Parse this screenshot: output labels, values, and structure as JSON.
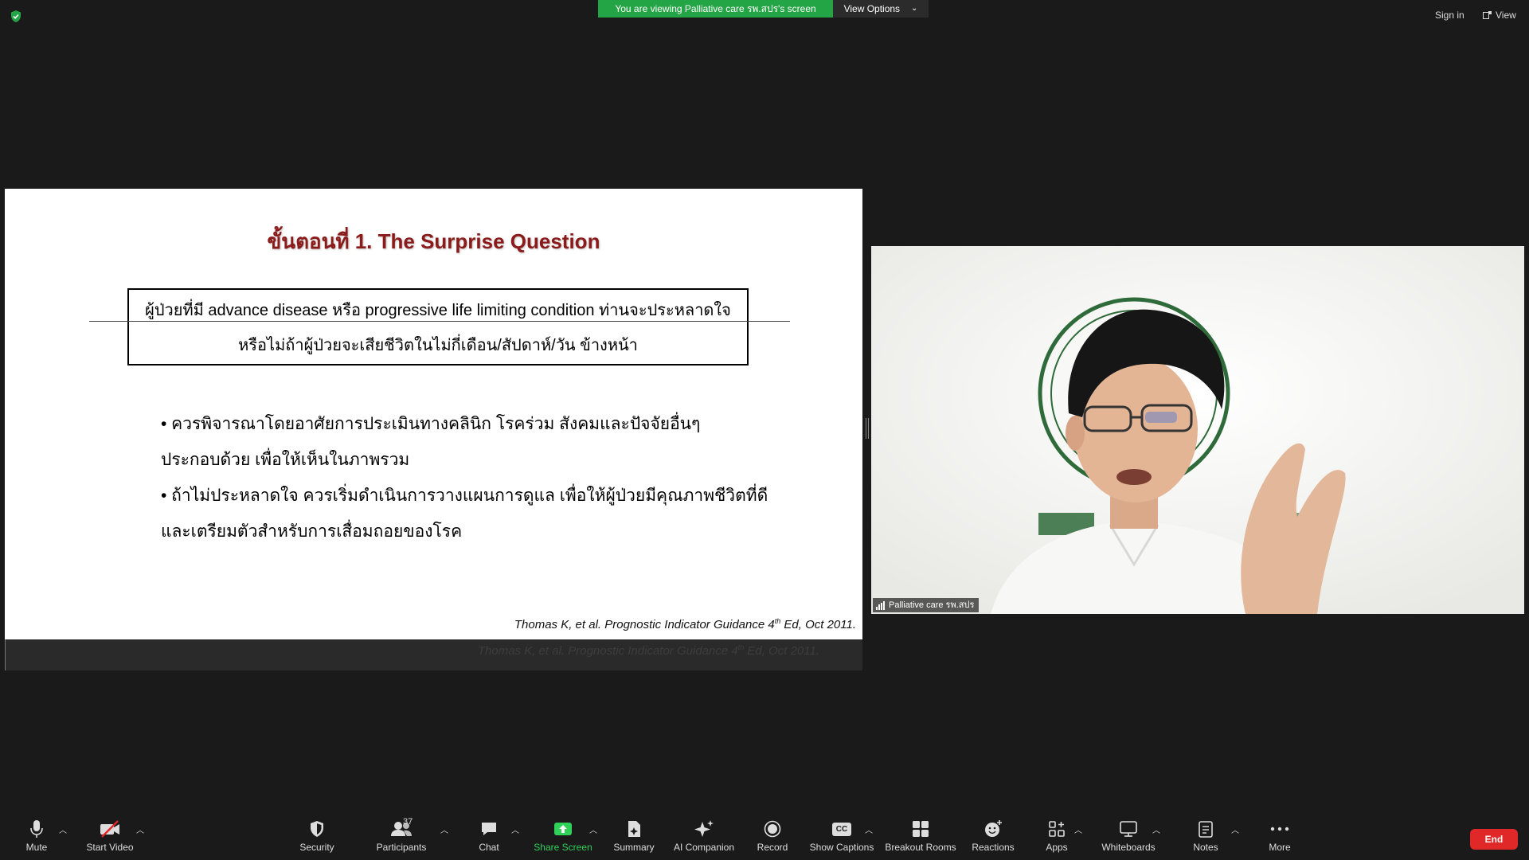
{
  "top_bar": {
    "banner": "You are viewing Palliative care รพ.สปร's screen",
    "view_options": "View Options",
    "sign_in": "Sign in",
    "view": "View"
  },
  "slide": {
    "title": "ขั้นตอนที่ 1.  The Surprise Question",
    "question_line1": "ผู้ป่วยที่มี advance disease หรือ progressive life limiting condition ท่านจะประหลาดใจ",
    "question_line2": "หรือไม่ถ้าผู้ป่วยจะเสียชีวิตในไม่กี่เดือน/สัปดาห์/วัน ข้างหน้า",
    "bullet1_line1": "• ควรพิจารณาโดยอาศัยการประเมินทางคลินิก โรคร่วม สังคมและปัจจัยอื่นๆ",
    "bullet1_line2": "ประกอบด้วย เพื่อให้เห็นในภาพรวม",
    "bullet2_line1": "• ถ้าไม่ประหลาดใจ ควรเริ่มดำเนินการวางแผนการดูแล เพื่อให้ผู้ป่วยมีคุณภาพชีวิตที่ดี",
    "bullet2_line2": "และเตรียมตัวสำหรับการเสื่อมถอยของโรค",
    "citation_pre": "Thomas K, et al. Prognostic Indicator Guidance 4",
    "citation_sup": "th",
    "citation_post": " Ed, Oct 2011."
  },
  "video": {
    "participant_name": "Palliative care รพ.สปร"
  },
  "toolbar": {
    "mute": "Mute",
    "start_video": "Start Video",
    "security": "Security",
    "participants": "Participants",
    "participants_count": "37",
    "chat": "Chat",
    "share_screen": "Share Screen",
    "summary": "Summary",
    "ai_companion": "AI Companion",
    "record": "Record",
    "show_captions": "Show Captions",
    "cc": "CC",
    "breakout_rooms": "Breakout Rooms",
    "reactions": "Reactions",
    "apps": "Apps",
    "whiteboards": "Whiteboards",
    "notes": "Notes",
    "more": "More",
    "end": "End"
  },
  "colors": {
    "banner_green": "#23a445",
    "share_green": "#2fd159",
    "end_red": "#e02828",
    "slide_title": "#8b1a1a"
  }
}
